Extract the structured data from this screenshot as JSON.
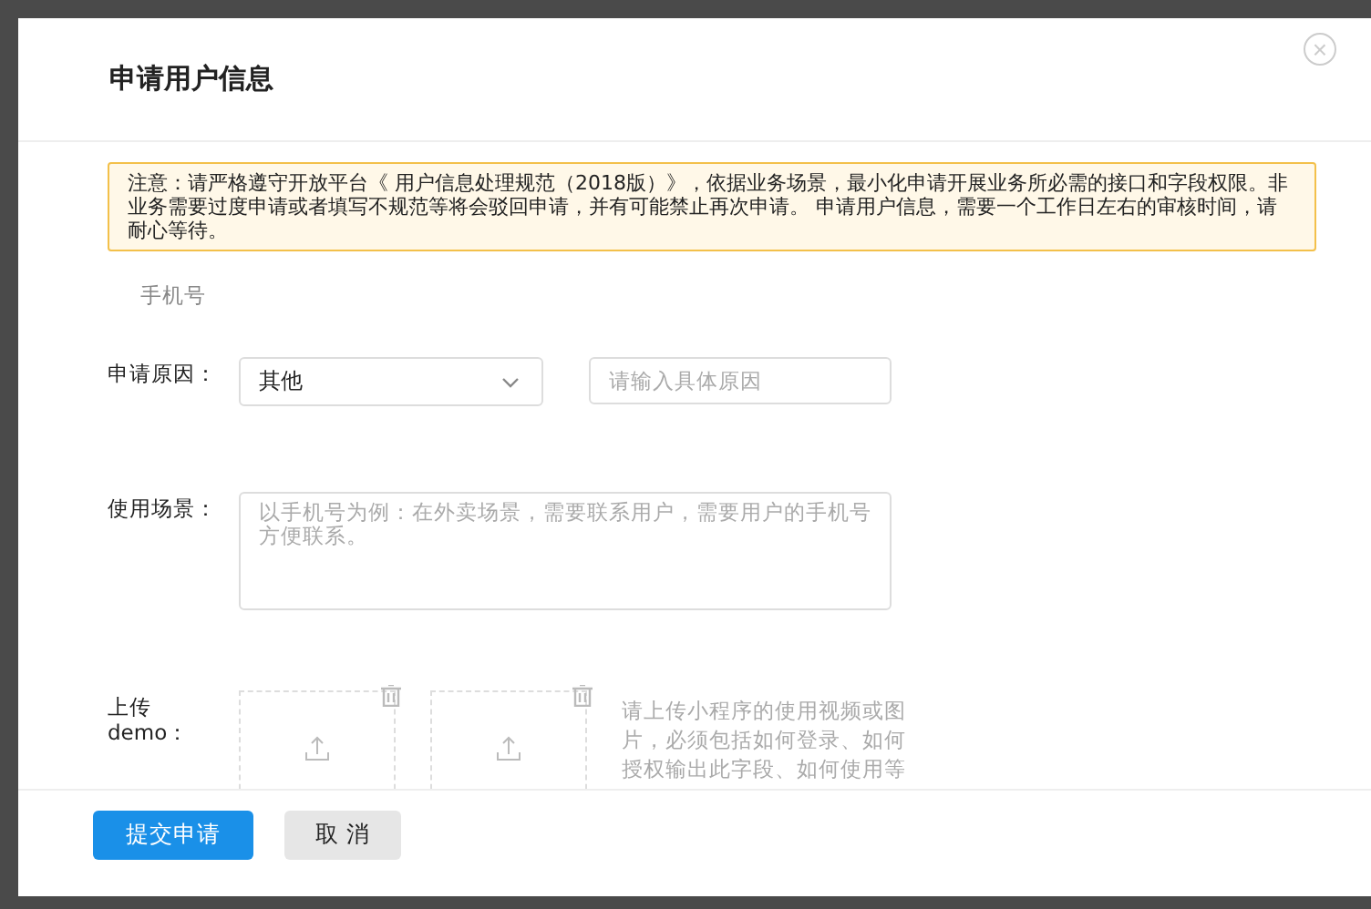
{
  "dialog": {
    "title": "申请用户信息",
    "close": "×"
  },
  "notice": "注意：请严格遵守开放平台《 用户信息处理规范（2018版）》，依据业务场景，最小化申请开展业务所必需的接口和字段权限。非业务需要过度申请或者填写不规范等将会驳回申请，并有可能禁止再次申请。 申请用户信息，需要一个工作日左右的审核时间，请耐心等待。",
  "field_name": "手机号",
  "reason": {
    "label": "申请原因：",
    "value": "其他",
    "detail_placeholder": "请输入具体原因"
  },
  "scene": {
    "label": "使用场景：",
    "placeholder": "以手机号为例：在外卖场景，需要联系用户，需要用户的手机号方便联系。"
  },
  "upload": {
    "label": "上传demo：",
    "hint": "请上传小程序的使用视频或图片，必须包括如何登录、如何授权输出此字段、如何使用等"
  },
  "buttons": [
    {
      "label": "提交申请",
      "kind": "primary"
    },
    {
      "label": "取 消",
      "kind": "default"
    }
  ]
}
